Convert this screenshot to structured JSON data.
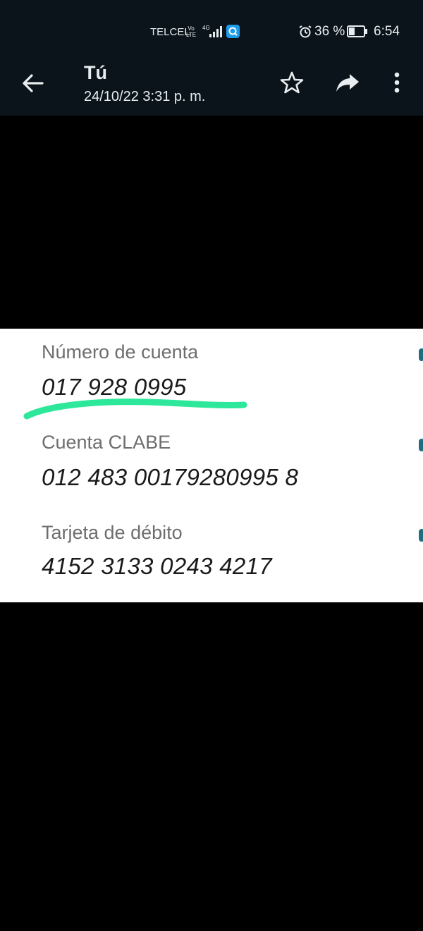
{
  "status_bar": {
    "carrier": "TELCEL",
    "volte_top": "Vo",
    "volte_bottom": "LTE",
    "network": "4G",
    "battery_percent": "36 %",
    "time": "6:54"
  },
  "app_bar": {
    "title": "Tú",
    "subtitle": "24/10/22 3:31 p. m."
  },
  "icons": {
    "back": "arrow-left-icon",
    "star": "star-icon",
    "share": "forward-icon",
    "more": "more-vert-icon"
  },
  "account_details": {
    "fields": [
      {
        "label": "Número de cuenta",
        "value": "017 928 0995"
      },
      {
        "label": "Cuenta CLABE",
        "value": "012 483 00179280995 8"
      },
      {
        "label": "Tarjeta de débito",
        "value": "4152 3133 0243 4217"
      }
    ]
  },
  "colors": {
    "app_bar_bg": "#0b141a",
    "highlight_stroke": "#2de89a",
    "app_badge": "#1e9be9"
  }
}
